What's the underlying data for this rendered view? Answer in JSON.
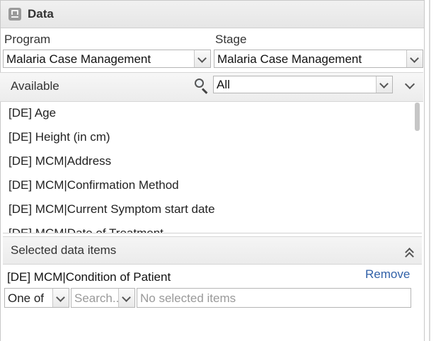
{
  "panel": {
    "title": "Data"
  },
  "program": {
    "label": "Program",
    "value": "Malaria Case Management"
  },
  "stage": {
    "label": "Stage",
    "value": "Malaria Case Management"
  },
  "available": {
    "label": "Available",
    "filter_value": "All",
    "items": [
      "[DE] Age",
      "[DE] Height (in cm)",
      "[DE] MCM|Address",
      "[DE] MCM|Confirmation Method",
      "[DE] MCM|Current Symptom start date",
      "[DE] MCM|Date of Treatment"
    ]
  },
  "selected": {
    "label": "Selected data items",
    "item_name": "[DE] MCM|Condition of Patient",
    "remove_label": "Remove",
    "operator_value": "One of",
    "search_placeholder": "Search...",
    "items_placeholder": "No selected items"
  }
}
